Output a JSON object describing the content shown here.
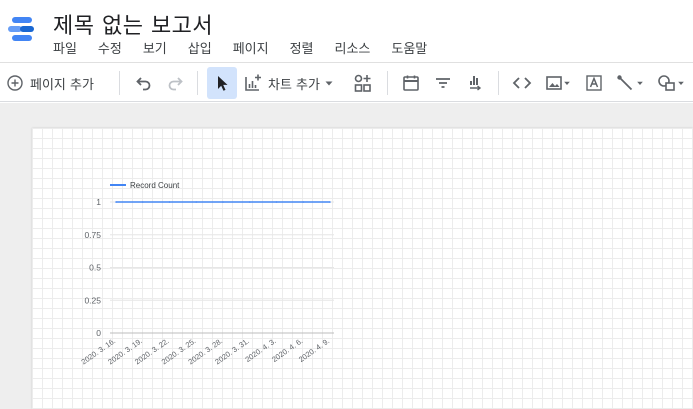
{
  "app": {
    "title": "제목 없는 보고서",
    "menu": [
      "파일",
      "수정",
      "보기",
      "삽입",
      "페이지",
      "정렬",
      "리소스",
      "도움말"
    ]
  },
  "toolbar": {
    "add_page_label": "페이지 추가",
    "add_chart_label": "차트 추가"
  },
  "colors": {
    "accent": "#1a73e8",
    "series_line": "#4285f4",
    "selected_bg": "#d2e3fc"
  },
  "chart_data": {
    "type": "line",
    "series": [
      {
        "name": "Record Count",
        "values": [
          1,
          1,
          1,
          1,
          1,
          1,
          1,
          1,
          1
        ]
      }
    ],
    "categories": [
      "2020. 3. 16.",
      "2020. 3. 19.",
      "2020. 3. 22.",
      "2020. 3. 25.",
      "2020. 3. 28.",
      "2020. 3. 31.",
      "2020. 4. 3.",
      "2020. 4. 6.",
      "2020. 4. 9."
    ],
    "yticks": [
      "0",
      "0.25",
      "0.5",
      "0.75",
      "1"
    ],
    "ylim": [
      0,
      1
    ],
    "legend": "top-left"
  }
}
